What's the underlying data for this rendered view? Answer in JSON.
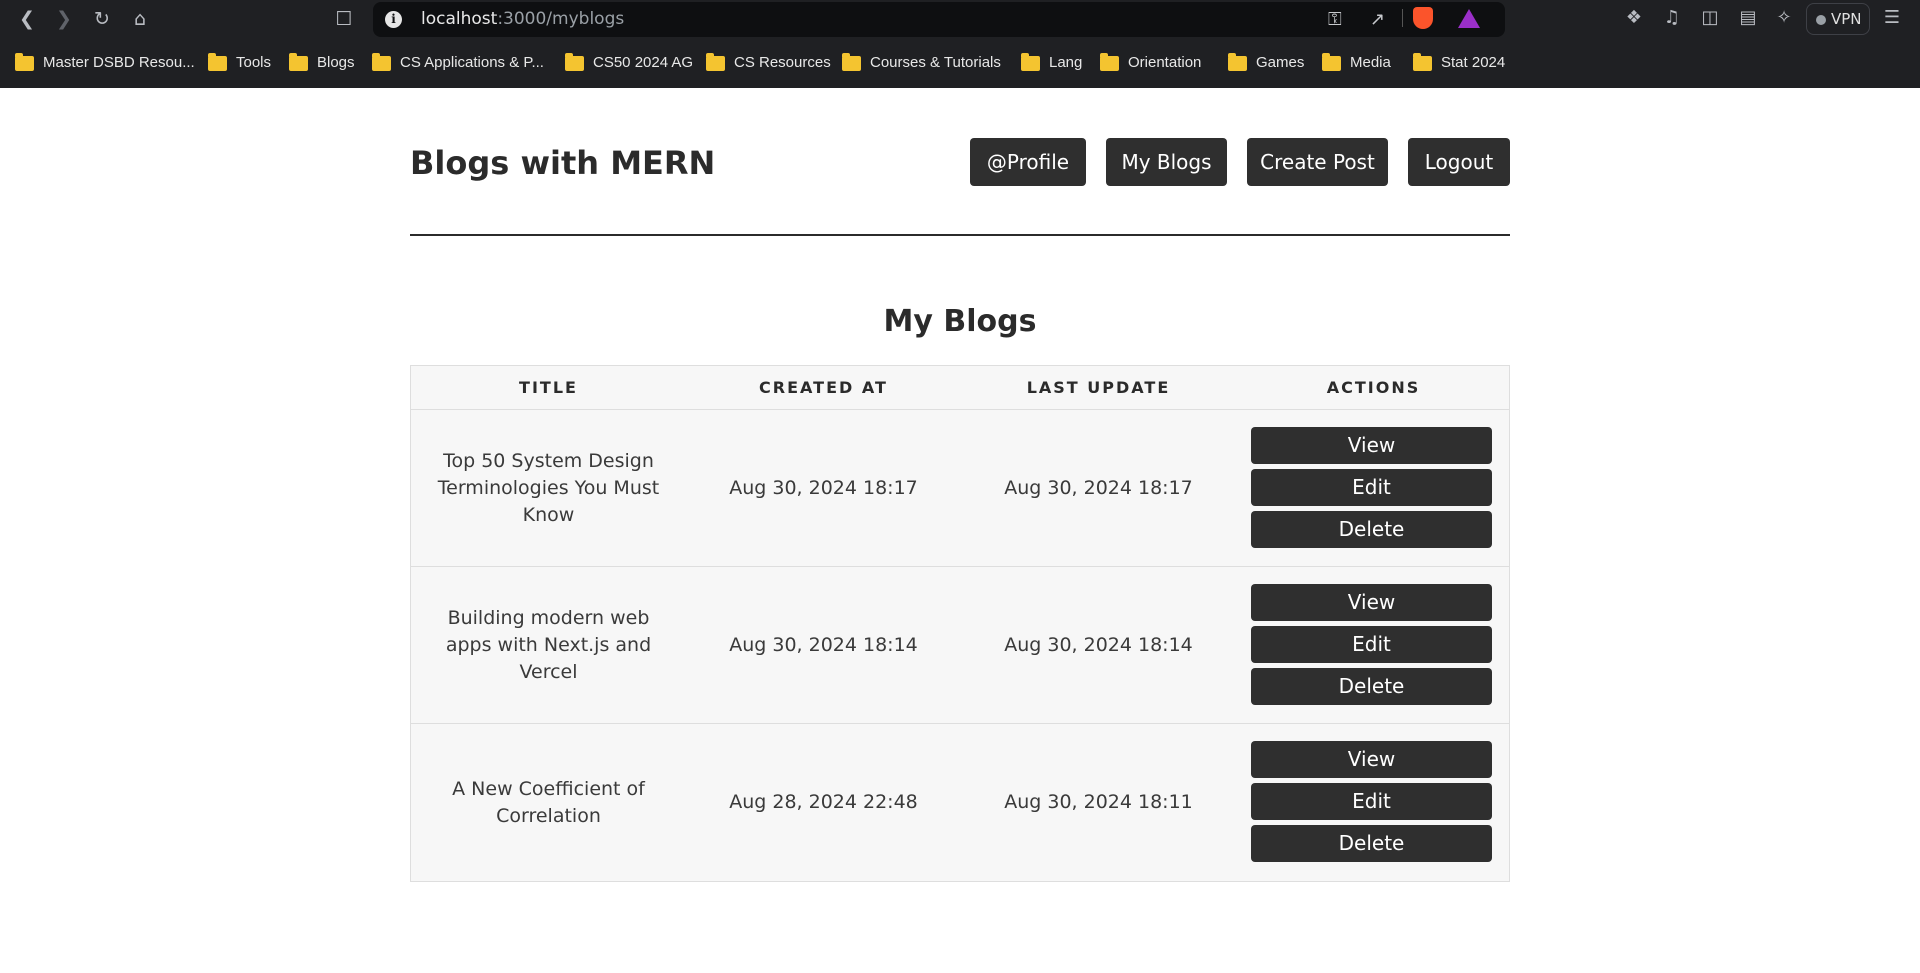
{
  "browser": {
    "url_host": "localhost",
    "url_path": ":3000/myblogs",
    "vpn_label": "VPN",
    "bookmarks": [
      "Master DSBD Resou...",
      "Tools",
      "Blogs",
      "CS Applications & P...",
      "CS50 2024 AG",
      "CS Resources",
      "Courses & Tutorials",
      "Lang",
      "Orientation",
      "Games",
      "Media",
      "Stat 2024"
    ]
  },
  "header": {
    "brand": "Blogs with MERN",
    "nav": [
      "@Profile",
      "My Blogs",
      "Create Post",
      "Logout"
    ]
  },
  "main": {
    "title": "My Blogs",
    "columns": [
      "TITLE",
      "CREATED AT",
      "LAST UPDATE",
      "ACTIONS"
    ],
    "action_labels": [
      "View",
      "Edit",
      "Delete"
    ],
    "rows": [
      {
        "title": "Top 50 System Design Terminologies You Must Know",
        "created": "Aug 30, 2024 18:17",
        "updated": "Aug 30, 2024 18:17"
      },
      {
        "title": "Building modern web apps with Next.js and Vercel",
        "created": "Aug 30, 2024 18:14",
        "updated": "Aug 30, 2024 18:14"
      },
      {
        "title": "A New Coefficient of Correlation",
        "created": "Aug 28, 2024 22:48",
        "updated": "Aug 30, 2024 18:11"
      }
    ]
  },
  "colors": {
    "chrome_bg": "#1f2023",
    "button_bg": "#2f2f2f",
    "table_bg": "#f7f7f7",
    "brave_orange": "#fb542b",
    "folder_yellow": "#f4c430"
  }
}
